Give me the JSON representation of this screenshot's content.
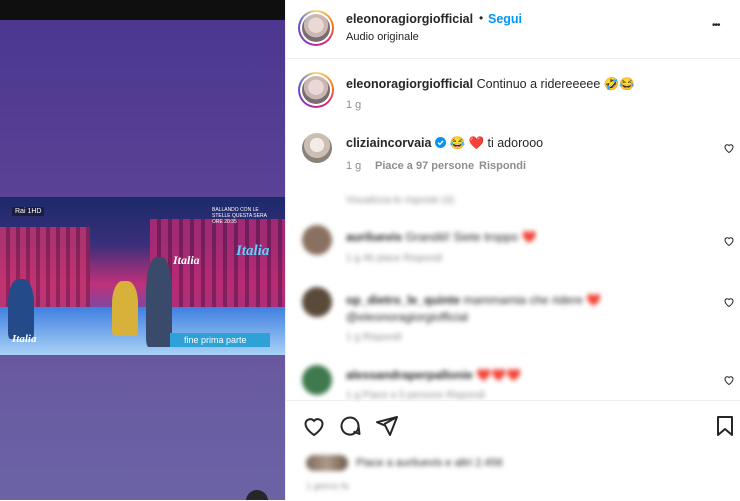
{
  "post": {
    "author": "eleonoragiorgiofficial",
    "follow_label": "Segui",
    "audio": "Audio originale",
    "more_label": "•••",
    "separator": "•"
  },
  "video": {
    "channel_badge": "Rai 1HD",
    "corner_logo": "Italia",
    "caption": "fine prima parte",
    "note": "BALLANDO CON LE STELLE QUESTA SERA ORE 20:35",
    "sign_left": "Italia",
    "sign_right": "Italia"
  },
  "caption": {
    "author": "eleonoragiorgiofficial",
    "text": "Continuo a ridereeeee 🤣😂",
    "time": "1 g"
  },
  "comments": [
    {
      "username": "cliziaincorvaia",
      "verified": true,
      "text": "😂 ❤️ ti adorooo",
      "time": "1 g",
      "likes": "Piace a 97 persone",
      "reply": "Rispondi"
    }
  ],
  "blurred": {
    "view_replies": "Visualizza le risposte (4)",
    "c1_user": "auriluevis",
    "c1_text": "Grandiii! Siete troppo ❤️",
    "c1_meta": "1 g   46 piace   Rispondi",
    "c2_user": "op_dietro_le_quinte",
    "c2_text": "mammamia che ridere ❤️ @eleonoragiorgiofficial",
    "c2_meta": "1 g   Rispondi",
    "c3_user": "alessandraperpallonie",
    "c3_text": "❤️❤️❤️",
    "c3_meta": "1 g   Piace a 5 persone   Rispondi",
    "likes_line": "Piace a auriluevis e altri 2.456",
    "date_line": "1 giorno fa"
  },
  "colors": {
    "accent": "#0095f6",
    "text": "#262626",
    "muted": "#8e8e8e",
    "media_bg": "#5c4596"
  }
}
